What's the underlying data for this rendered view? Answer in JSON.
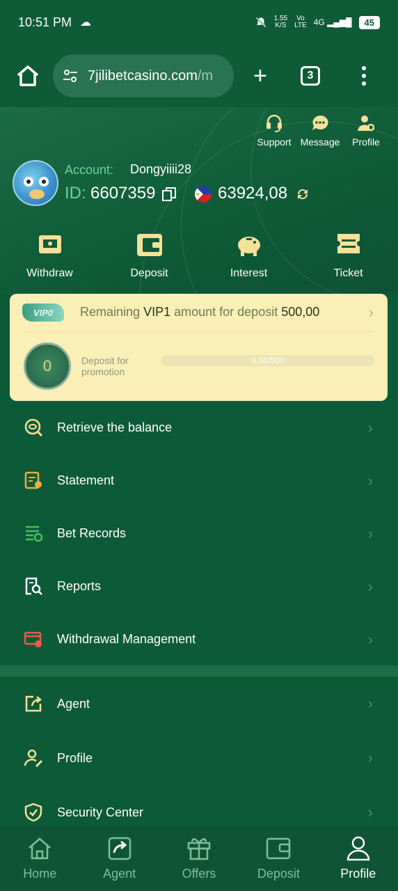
{
  "status_bar": {
    "time": "10:51 PM",
    "speed": "1.55",
    "speed_unit": "K/S",
    "network1": "Vo",
    "network2": "LTE",
    "network3": "4G",
    "battery": "45"
  },
  "browser": {
    "url": "7jilibetcasino.com",
    "url_suffix": "/m",
    "tab_count": "3",
    "plus": "+"
  },
  "header": {
    "support": "Support",
    "message": "Message",
    "profile": "Profile",
    "account_label": "Account:",
    "account_name": "Dongyiiii28",
    "id_label": "ID:",
    "id_value": "6607359",
    "balance": "63924,08"
  },
  "actions": [
    {
      "label": "Withdraw"
    },
    {
      "label": "Deposit"
    },
    {
      "label": "Interest"
    },
    {
      "label": "Ticket"
    }
  ],
  "vip": {
    "badge": "VIP0",
    "text_prefix": "Remaining",
    "level": "VIP1",
    "text_mid": "amount for deposit",
    "amount": "500,00",
    "coin_value": "0",
    "promo_label": "Deposit for promotion",
    "progress_text": "0,00/500",
    "progress_fraction": 0
  },
  "menu": [
    {
      "label": "Retrieve the balance"
    },
    {
      "label": "Statement"
    },
    {
      "label": "Bet Records"
    },
    {
      "label": "Reports"
    },
    {
      "label": "Withdrawal Management"
    },
    {
      "label": "Agent"
    },
    {
      "label": "Profile"
    },
    {
      "label": "Security Center"
    }
  ],
  "tabbar": [
    {
      "label": "Home"
    },
    {
      "label": "Agent"
    },
    {
      "label": "Offers"
    },
    {
      "label": "Deposit"
    },
    {
      "label": "Profile"
    }
  ],
  "colors": {
    "accent_green": "#6fd49a",
    "icon_gold": "#f7e09a",
    "vip_card": "#fbefb8"
  }
}
